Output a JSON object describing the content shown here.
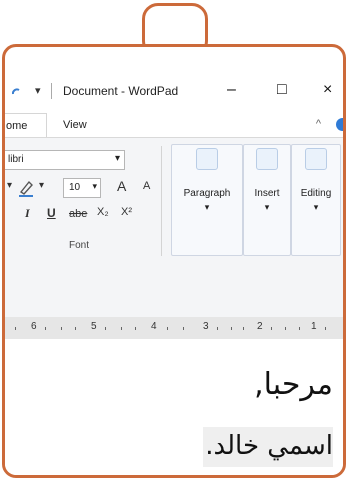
{
  "titlebar": {
    "quick_access_dropdown": "▾",
    "title": "Document - WordPad",
    "minimize": "–",
    "maximize": "□",
    "close": "×"
  },
  "menubar": {
    "tabs": [
      {
        "label": "ome"
      },
      {
        "label": "View"
      }
    ],
    "collapse": "^"
  },
  "ribbon": {
    "font_name": "libri",
    "font_size": "10",
    "grow_font": "A",
    "shrink_font": "A",
    "italic": "I",
    "underline": "U",
    "strikethrough": "abe",
    "subscript": "X₂",
    "superscript": "X²",
    "font_group_label": "Font",
    "paragraph_label": "Paragraph",
    "insert_label": "Insert",
    "editing_label": "Editing"
  },
  "ruler": {
    "marks": [
      "6",
      "5",
      "4",
      "3",
      "2",
      "1"
    ]
  },
  "document": {
    "line1": "مرحبا,",
    "line2": "اسمي خالد."
  },
  "colors": {
    "frame_accent": "#cc6a3a",
    "help_blue": "#2f7bd6"
  }
}
